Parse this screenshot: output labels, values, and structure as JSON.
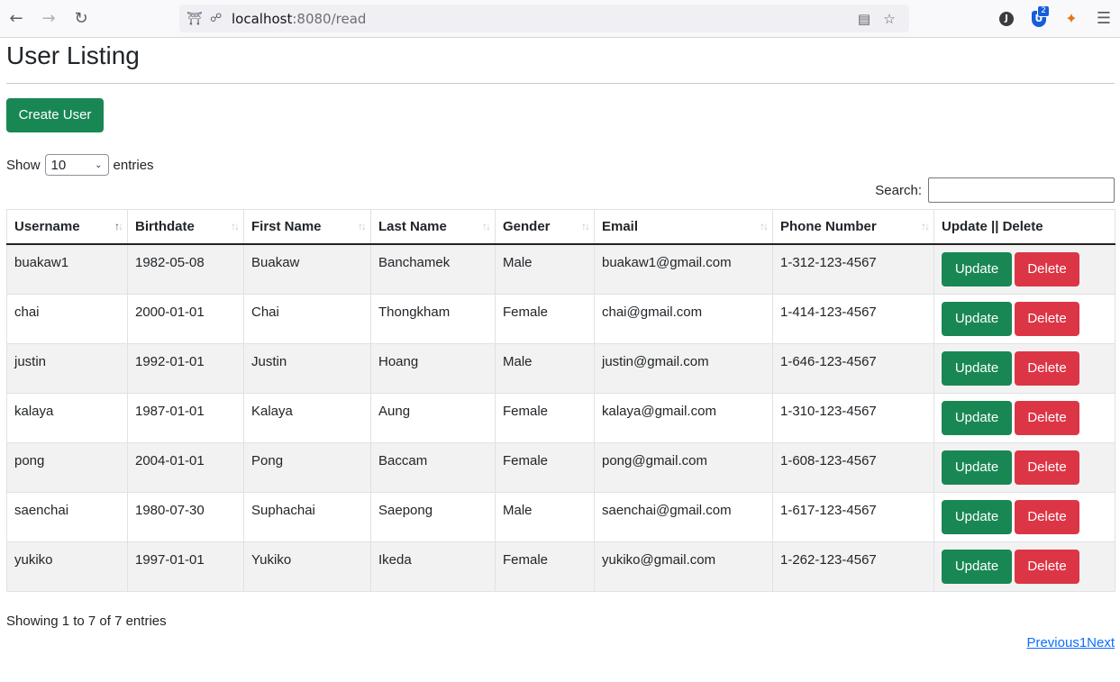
{
  "browser": {
    "url_host": "localhost",
    "url_path": ":8080/read",
    "extension_badge": "2",
    "avatar_letter": "J",
    "ext_letter": "U"
  },
  "page": {
    "title": "User Listing",
    "create_label": "Create User"
  },
  "length": {
    "show": "Show",
    "value": "10",
    "entries": "entries"
  },
  "search": {
    "label": "Search:",
    "value": ""
  },
  "table": {
    "headers": [
      "Username",
      "Birthdate",
      "First Name",
      "Last Name",
      "Gender",
      "Email",
      "Phone Number",
      "Update || Delete"
    ],
    "update_label": "Update",
    "delete_label": "Delete",
    "rows": [
      [
        "buakaw1",
        "1982-05-08",
        "Buakaw",
        "Banchamek",
        "Male",
        "buakaw1@gmail.com",
        "1-312-123-4567"
      ],
      [
        "chai",
        "2000-01-01",
        "Chai",
        "Thongkham",
        "Female",
        "chai@gmail.com",
        "1-414-123-4567"
      ],
      [
        "justin",
        "1992-01-01",
        "Justin",
        "Hoang",
        "Male",
        "justin@gmail.com",
        "1-646-123-4567"
      ],
      [
        "kalaya",
        "1987-01-01",
        "Kalaya",
        "Aung",
        "Female",
        "kalaya@gmail.com",
        "1-310-123-4567"
      ],
      [
        "pong",
        "2004-01-01",
        "Pong",
        "Baccam",
        "Female",
        "pong@gmail.com",
        "1-608-123-4567"
      ],
      [
        "saenchai",
        "1980-07-30",
        "Suphachai",
        "Saepong",
        "Male",
        "saenchai@gmail.com",
        "1-617-123-4567"
      ],
      [
        "yukiko",
        "1997-01-01",
        "Yukiko",
        "Ikeda",
        "Female",
        "yukiko@gmail.com",
        "1-262-123-4567"
      ]
    ]
  },
  "footer": {
    "info": "Showing 1 to 7 of 7 entries",
    "previous": "Previous",
    "page": "1",
    "next": "Next"
  },
  "colors": {
    "success": "#198754",
    "danger": "#dc3545",
    "link": "#0d6efd"
  }
}
